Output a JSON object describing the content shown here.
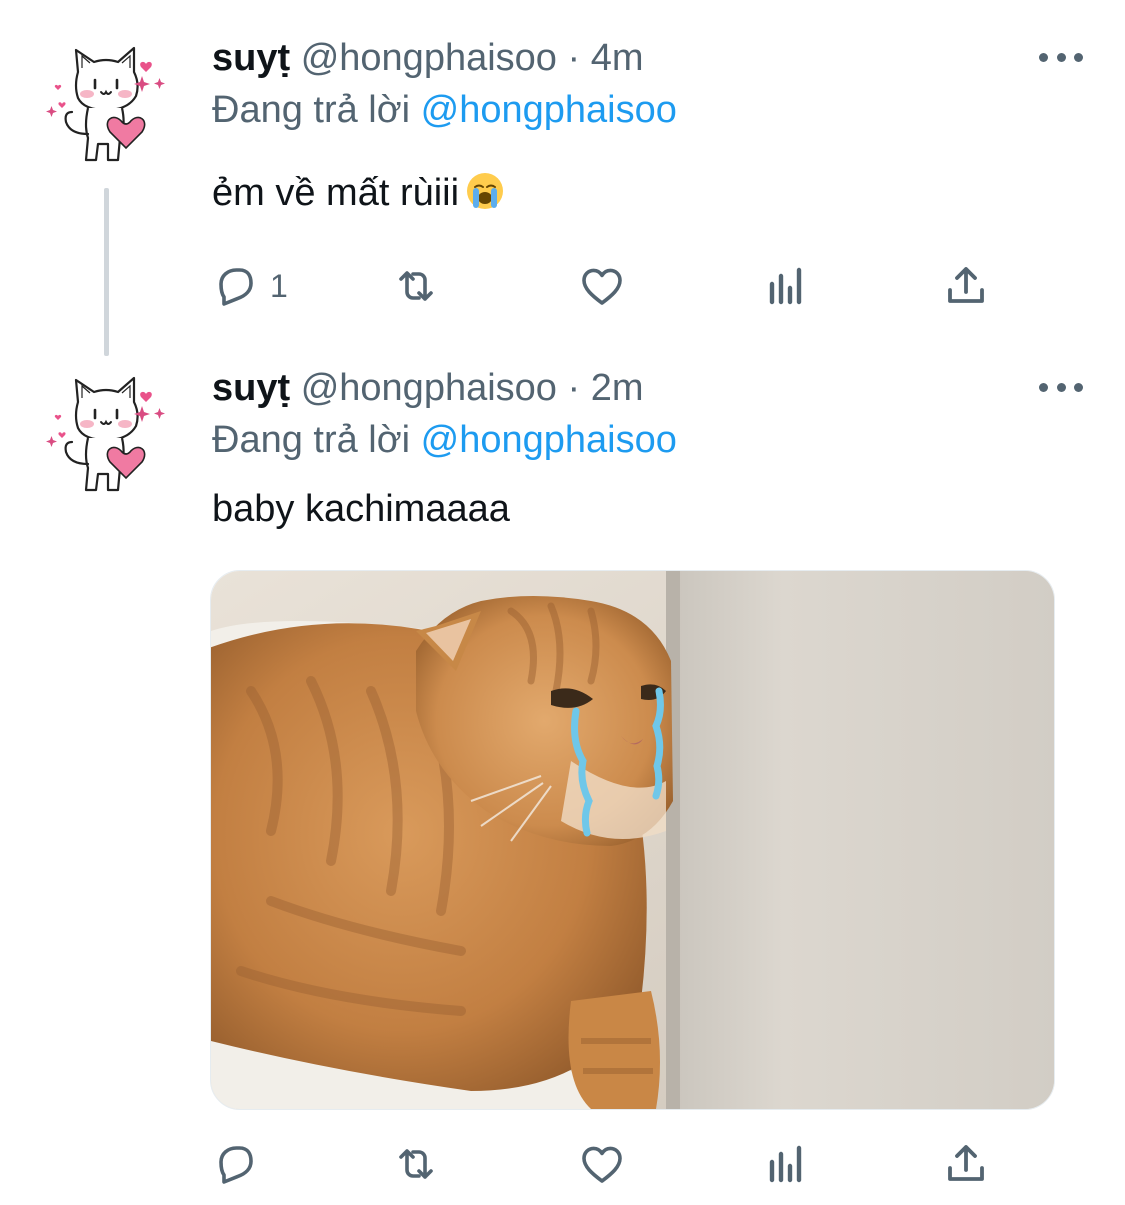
{
  "tweets": [
    {
      "name": "suyṭ",
      "handle": "@hongphaisoo",
      "separator": "·",
      "time": "4m",
      "reply_prefix": "Đang trả lời",
      "reply_handle": "@hongphaisoo",
      "text": "ẻm về mất rùiii",
      "text_emoji": "loudly-crying-face",
      "avatar": "cat-holding-heart-icon",
      "actions": {
        "reply": {
          "icon": "reply-icon",
          "count": "1"
        },
        "retweet": {
          "icon": "retweet-icon",
          "count": ""
        },
        "like": {
          "icon": "heart-icon",
          "count": ""
        },
        "views": {
          "icon": "analytics-icon",
          "count": ""
        },
        "share": {
          "icon": "share-icon",
          "count": ""
        }
      }
    },
    {
      "name": "suyṭ",
      "handle": "@hongphaisoo",
      "separator": "·",
      "time": "2m",
      "reply_prefix": "Đang trả lời",
      "reply_handle": "@hongphaisoo",
      "text": "baby kachimaaaa",
      "media": "crying-orange-cat-photo",
      "avatar": "cat-holding-heart-icon",
      "actions": {
        "reply": {
          "icon": "reply-icon",
          "count": ""
        },
        "retweet": {
          "icon": "retweet-icon",
          "count": ""
        },
        "like": {
          "icon": "heart-icon",
          "count": ""
        },
        "views": {
          "icon": "analytics-icon",
          "count": ""
        },
        "share": {
          "icon": "share-icon",
          "count": ""
        }
      }
    }
  ],
  "colors": {
    "text": "#0f1419",
    "secondary": "#536471",
    "link": "#1d9bf0",
    "thread_line": "#d0d6db"
  }
}
